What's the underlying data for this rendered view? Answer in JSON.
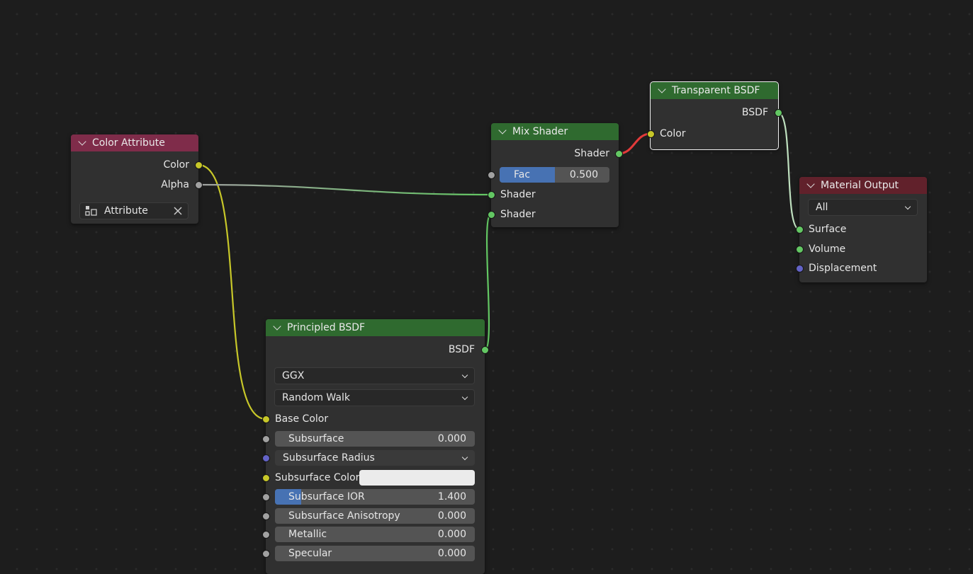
{
  "colors": {
    "header_color_attribute": "#7f2c4a",
    "header_shader": "#2f6a2f",
    "header_output": "#61212b",
    "socket_shader": "#63c763",
    "socket_color": "#c7c729",
    "socket_float": "#a1a1a1",
    "socket_vector": "#6363c7",
    "field_fill": "#4772b3",
    "subsurface_color_value": "#ebebeb"
  },
  "color_attribute": {
    "title": "Color Attribute",
    "outputs": [
      "Color",
      "Alpha"
    ],
    "attribute_field": {
      "value": "Attribute",
      "icon": "color-attribute-icon",
      "clear_icon": "close-icon"
    }
  },
  "mix_shader": {
    "title": "Mix Shader",
    "output": "Shader",
    "fac": {
      "label": "Fac",
      "value": "0.500",
      "fraction": 0.5
    },
    "inputs": [
      "Shader",
      "Shader"
    ]
  },
  "transparent_bsdf": {
    "title": "Transparent BSDF",
    "output": "BSDF",
    "input": "Color"
  },
  "material_output": {
    "title": "Material Output",
    "target": "All",
    "inputs": [
      "Surface",
      "Volume",
      "Displacement"
    ]
  },
  "principled_bsdf": {
    "title": "Principled BSDF",
    "output": "BSDF",
    "distribution": "GGX",
    "subsurface_method": "Random Walk",
    "base_color_label": "Base Color",
    "subsurface": {
      "label": "Subsurface",
      "value": "0.000",
      "fraction": 0.0
    },
    "subsurface_radius": "Subsurface Radius",
    "subsurface_color_label": "Subsurface Color",
    "subsurface_ior": {
      "label": "Subsurface IOR",
      "value": "1.400",
      "fraction": 0.13
    },
    "subsurface_anisotropy": {
      "label": "Subsurface Anisotropy",
      "value": "0.000",
      "fraction": 0.0
    },
    "metallic": {
      "label": "Metallic",
      "value": "0.000",
      "fraction": 0.0
    },
    "specular": {
      "label": "Specular",
      "value": "0.000",
      "fraction": 0.0
    }
  }
}
